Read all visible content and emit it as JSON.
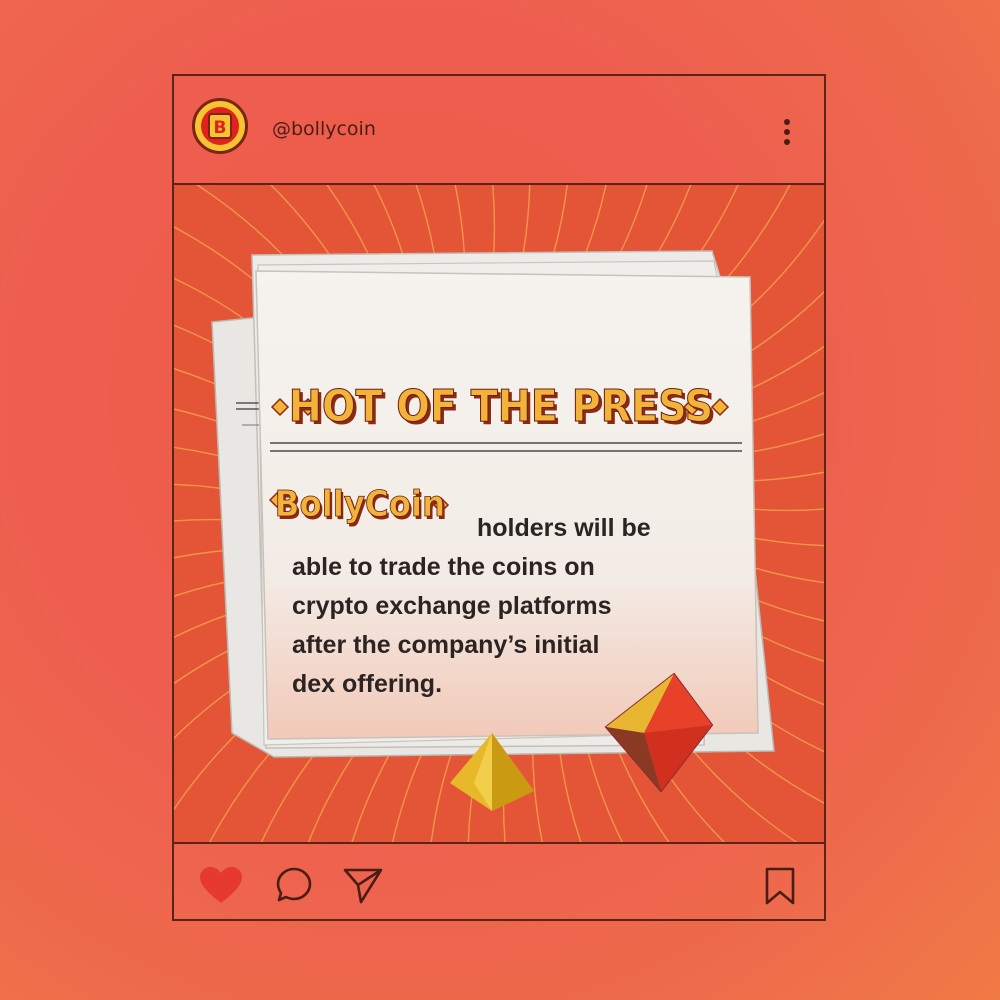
{
  "post": {
    "handle": "@bollycoin",
    "avatar_letter": "B",
    "headline": "HOT OF THE PRESS",
    "brand_word": "BollyCoin",
    "body_line_1": "holders will be",
    "body_lines": [
      "able to trade the coins on",
      "crypto exchange platforms",
      "after the company’s initial",
      "dex offering."
    ]
  },
  "icons": {
    "more": "more-vertical-icon",
    "like": "heart-icon",
    "comment": "comment-icon",
    "share": "send-icon",
    "save": "bookmark-icon"
  },
  "colors": {
    "background": "#ee5e4f",
    "frame": "#5a2418",
    "panel": "#e45437",
    "ray": "#f3a24a",
    "paper": "#f4f1ec",
    "headline_fill": "#f3b23a",
    "headline_shadow": "#8e2a14",
    "like_red": "#e73a2e",
    "avatar_gold": "#f6c431"
  }
}
